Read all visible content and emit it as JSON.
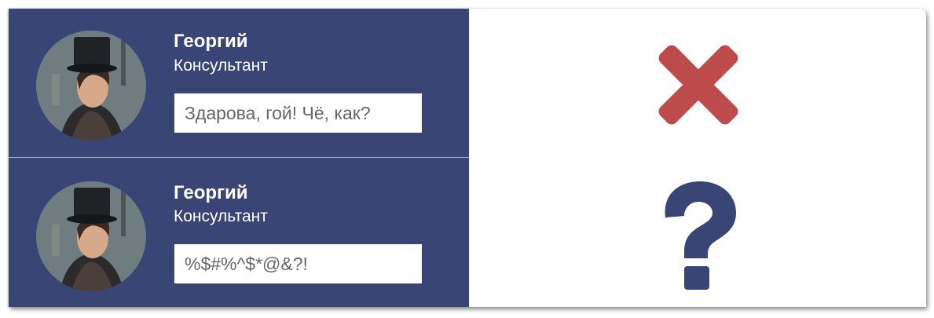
{
  "rows": [
    {
      "name": "Георгий",
      "role": "Консультант",
      "message": "Здарова, гой! Чё, как?",
      "status_icon": "cross-icon",
      "status_color": "#bd4b4b"
    },
    {
      "name": "Георгий",
      "role": "Консультант",
      "message": "%$#%^$*@&?!",
      "status_icon": "question-mark-icon",
      "status_color": "#384575"
    }
  ],
  "colors": {
    "panel": "#384575",
    "message_text": "#666666"
  }
}
